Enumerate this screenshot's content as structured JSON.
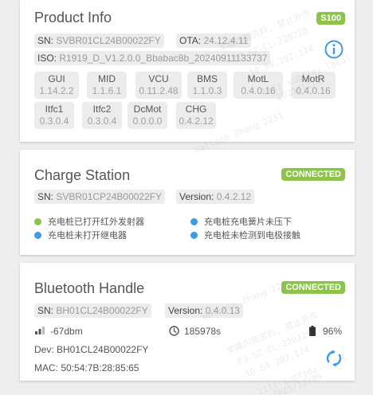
{
  "product": {
    "title": "Product Info",
    "badge": "S100",
    "sn_label": "SN: ",
    "sn_value": "SVBR01CL24B00022FY",
    "ota_label": "OTA: ",
    "ota_value": "24.12.4.11",
    "iso_label": "ISO: ",
    "iso_value": "R1919_D_V1.2.0.0_Bbabac8b_20240911133737",
    "versions": [
      {
        "name": "GUI",
        "value": "1.14.2.2"
      },
      {
        "name": "MID",
        "value": "1.1.6.1"
      },
      {
        "name": "VCU",
        "value": "0.11.2.48"
      },
      {
        "name": "BMS",
        "value": "1.1.0.3"
      },
      {
        "name": "MotL",
        "value": "0.4.0.16"
      },
      {
        "name": "MotR",
        "value": "0.4.0.16"
      },
      {
        "name": "Itfc1",
        "value": "0.3.0.4"
      },
      {
        "name": "Itfc2",
        "value": "0.3.0.4"
      },
      {
        "name": "DcMot",
        "value": "0.0.0.0"
      },
      {
        "name": "CHG",
        "value": "0.4.2.12"
      }
    ]
  },
  "charge": {
    "title": "Charge Station",
    "badge": "CONNECTED",
    "sn_label": "SN: ",
    "sn_value": "SVBR01CP24B00022FY",
    "version_label": "Version: ",
    "version_value": "0.4.2.12",
    "statuses": [
      {
        "text": "充电桩已打开红外发射器",
        "color": "#8cc34b"
      },
      {
        "text": "充电桩充电簧片未压下",
        "color": "#3f9ae6"
      },
      {
        "text": "充电桩未打开继电器",
        "color": "#3f9ae6"
      },
      {
        "text": "充电桩未检测到电极接触",
        "color": "#3f9ae6"
      }
    ]
  },
  "bluetooth": {
    "title": "Bluetooth Handle",
    "badge": "CONNECTED",
    "sn_label": "SN: ",
    "sn_value": "BH01CL24B00022FY",
    "version_label": "Version: ",
    "version_value": "0.4.0.13",
    "signal": "-67dbm",
    "uptime": "185978s",
    "battery": "96%",
    "dev": "Dev: BH01CL24B00022FY",
    "mac": "MAC: 50:54:7B:28:85:65"
  },
  "colors": {
    "accent_green": "#8cc34b",
    "accent_blue": "#3f9ae6"
  },
  "watermark": {
    "name": "Wallace Zhang 2231",
    "line1": "丰疆内部资料, 禁止外传",
    "line2": "FJ-SZ-CL-220220",
    "line3": "10.64.202.174",
    "line4": "lili.xu@fjdz.local",
    "line5": "2025/12/09"
  }
}
